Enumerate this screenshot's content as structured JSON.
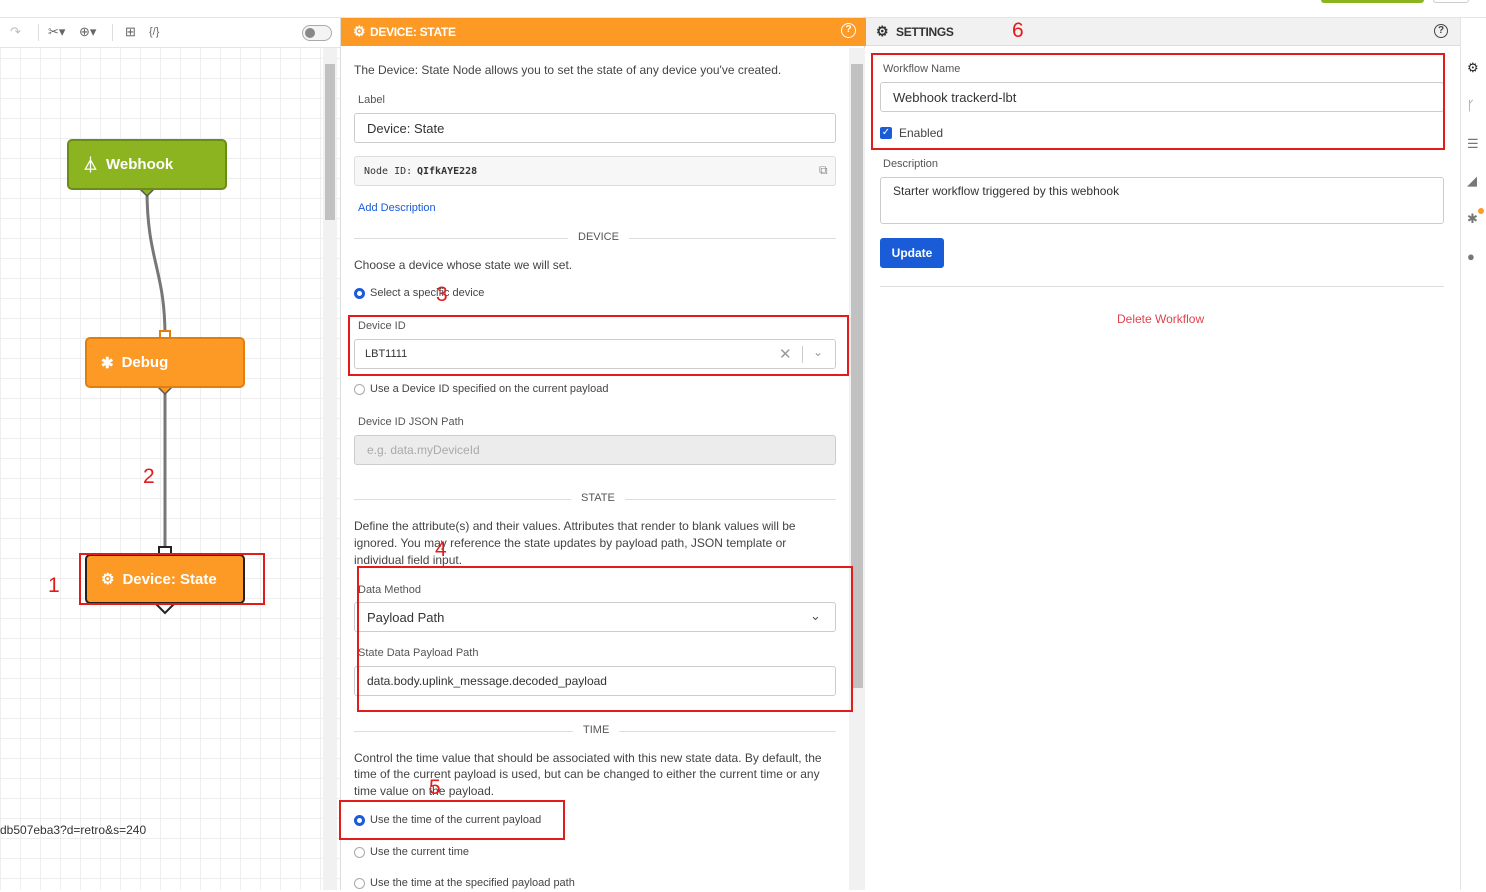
{
  "canvas": {
    "toolbar": {
      "redo": "↷",
      "cut": "✂▾",
      "zoom": "⊕▾",
      "add": "⊞",
      "code": "{/}"
    },
    "nodes": [
      {
        "label": "Webhook",
        "icon": "webhook-icon"
      },
      {
        "label": "Debug",
        "icon": "bug-icon"
      },
      {
        "label": "Device: State",
        "icon": "device-state-icon"
      }
    ],
    "url_fragment": "db507eba3?d=retro&s=240",
    "annotations": [
      "1",
      "2"
    ]
  },
  "node_panel": {
    "title": "DEVICE: STATE",
    "help": "?",
    "intro": "The Device: State Node allows you to set the state of any device you've created.",
    "label_caption": "Label",
    "label_value": "Device: State",
    "node_id_caption": "Node ID:",
    "node_id_value": "QIfkAYE228",
    "add_description": "Add Description",
    "device_section": "DEVICE",
    "device_desc": "Choose a device whose state we will set.",
    "radio_specific": "Select a specific device",
    "device_id_label": "Device ID",
    "device_id_value": "LBT1111",
    "radio_payload": "Use a Device ID specified on the current payload",
    "json_path_label": "Device ID JSON Path",
    "json_path_placeholder": "e.g. data.myDeviceId",
    "state_section": "STATE",
    "state_desc_1": "Define the attribute(s) and their values. Attributes that render to blank values will be",
    "state_desc_2": "ignored. You may reference the state updates by payload path, JSON template or",
    "state_desc_3": "individual field input.",
    "data_method_label": "Data Method",
    "data_method_value": "Payload Path",
    "payload_path_label": "State Data Payload Path",
    "payload_path_value": "data.body.uplink_message.decoded_payload",
    "time_section": "TIME",
    "time_desc_1": "Control the time value that should be associated with this new state data. By default, the",
    "time_desc_2": "time of the current payload is used, but can be changed to either the current time or any",
    "time_desc_3": "time value on the payload.",
    "time_opt_1": "Use the time of the current payload",
    "time_opt_2": "Use the current time",
    "time_opt_3": "Use the time at the specified payload path",
    "annotations": [
      "3",
      "4",
      "5"
    ]
  },
  "settings": {
    "title": "SETTINGS",
    "help": "?",
    "workflow_name_label": "Workflow Name",
    "workflow_name_value": "Webhook trackerd-lbt",
    "enabled_label": "Enabled",
    "description_label": "Description",
    "description_value": "Starter workflow triggered by this webhook",
    "update_button": "Update",
    "delete_link": "Delete Workflow",
    "annotation": "6"
  },
  "rail": [
    "gear-icon",
    "branch-icon",
    "database-icon",
    "chart-icon",
    "bug-icon",
    "globe-icon"
  ],
  "colors": {
    "webhook": "#8cb420",
    "debug": "#fd9a26",
    "accent": "#1a5bd8",
    "annotation": "#e21b1b",
    "delete": "#e0434e"
  }
}
